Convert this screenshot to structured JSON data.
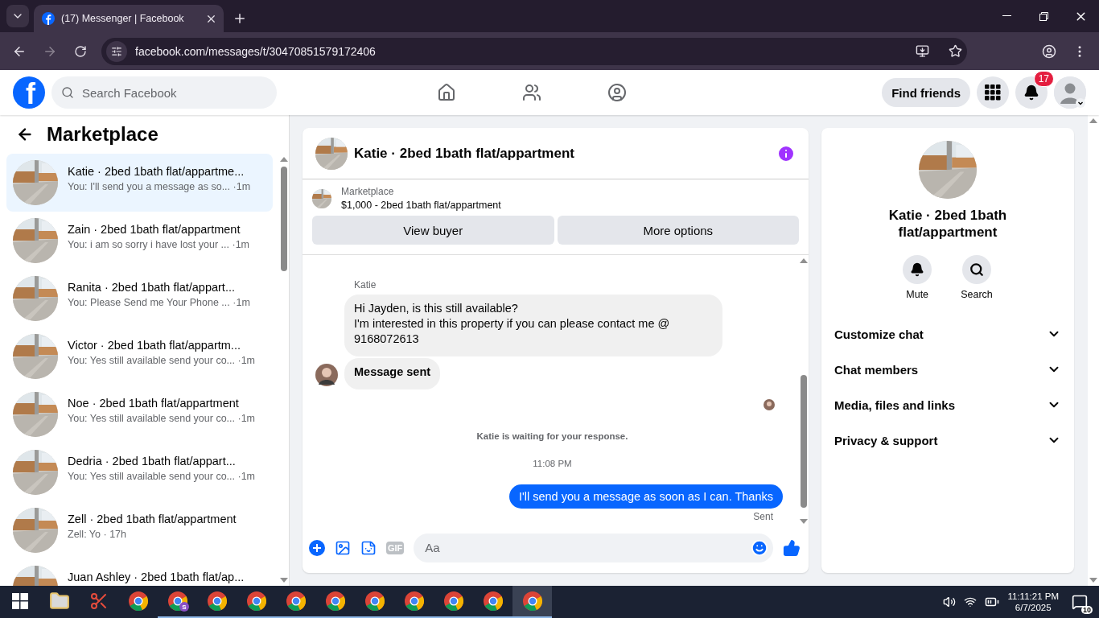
{
  "browser": {
    "tab": {
      "title": "(17) Messenger | Facebook",
      "selected": true
    },
    "url": "facebook.com/messages/t/30470851579172406"
  },
  "header": {
    "logo": "f",
    "search_placeholder": "Search Facebook",
    "find_friends": "Find friends",
    "notification_count": "17"
  },
  "sidebar": {
    "title": "Marketplace",
    "conversations": [
      {
        "name": "Katie · 2bed 1bath flat/appartme...",
        "snippet": "You: I'll send you a message as so...",
        "time": "·1m",
        "selected": true
      },
      {
        "name": "Zain · 2bed 1bath flat/appartment",
        "snippet": "You: i am so sorry i have lost your ...",
        "time": "·1m",
        "selected": false
      },
      {
        "name": "Ranita · 2bed 1bath flat/appart...",
        "snippet": "You: Please Send me Your Phone ...",
        "time": "·1m",
        "selected": false
      },
      {
        "name": "Victor · 2bed 1bath flat/appartm...",
        "snippet": "You: Yes still available send your co...",
        "time": "·1m",
        "selected": false
      },
      {
        "name": "Noe · 2bed 1bath flat/appartment",
        "snippet": "You: Yes still available send your co...",
        "time": "·1m",
        "selected": false
      },
      {
        "name": "Dedria · 2bed 1bath flat/appart...",
        "snippet": "You: Yes still available send your co...",
        "time": "·1m",
        "selected": false
      },
      {
        "name": "Zell · 2bed 1bath flat/appartment",
        "snippet": "Zell: Yo",
        "time": "· 17h",
        "selected": false
      },
      {
        "name": "Juan Ashley · 2bed 1bath flat/ap...",
        "selected": false
      }
    ]
  },
  "chat": {
    "title": "Katie · 2bed 1bath flat/appartment",
    "listing": {
      "label": "Marketplace",
      "title": "$1,000 - 2bed 1bath flat/appartment",
      "buttons": [
        "View buyer",
        "More options"
      ]
    },
    "messages": [
      {
        "kind": "sender",
        "text": "Katie"
      },
      {
        "kind": "incoming",
        "text": "Hi Jayden, is this still available?\nI'm interested in this property if you can please contact me @ 9168072613",
        "bold": false,
        "avatar": false
      },
      {
        "kind": "incoming",
        "text": "Message sent",
        "bold": true,
        "avatar": true
      },
      {
        "kind": "seen"
      },
      {
        "kind": "notice",
        "text": "Katie is waiting for your response."
      },
      {
        "kind": "time",
        "text": "11:08 PM"
      },
      {
        "kind": "outgoing",
        "text": "I'll send you a message as soon as I can. Thanks"
      },
      {
        "kind": "status",
        "text": "Sent"
      }
    ],
    "composer": {
      "gif": "GIF",
      "placeholder": "Aa"
    }
  },
  "details": {
    "name": "Katie · 2bed 1bath flat/appartment",
    "actions": [
      {
        "kind": "mute",
        "label": "Mute"
      },
      {
        "kind": "search",
        "label": "Search"
      }
    ],
    "sections": [
      {
        "label": "Customize chat",
        "expanded": false
      },
      {
        "label": "Chat members",
        "expanded": false
      },
      {
        "label": "Media, files and links",
        "expanded": false
      },
      {
        "label": "Privacy & support",
        "expanded": false
      }
    ]
  },
  "taskbar": {
    "apps": [
      {
        "kind": "files",
        "running": false,
        "selected": false
      },
      {
        "kind": "snip",
        "running": false,
        "selected": false
      },
      {
        "kind": "chrome",
        "running": false,
        "selected": false
      },
      {
        "kind": "chrome",
        "badge": "S",
        "running": true,
        "selected": false
      },
      {
        "kind": "chrome",
        "running": true,
        "selected": false
      },
      {
        "kind": "chrome",
        "running": true,
        "selected": false
      },
      {
        "kind": "chrome",
        "running": true,
        "selected": false
      },
      {
        "kind": "chrome",
        "running": true,
        "selected": false
      },
      {
        "kind": "chrome",
        "running": true,
        "selected": false
      },
      {
        "kind": "chrome",
        "running": true,
        "selected": false
      },
      {
        "kind": "chrome",
        "running": true,
        "selected": false
      },
      {
        "kind": "chrome",
        "running": true,
        "selected": false
      },
      {
        "kind": "chrome",
        "running": true,
        "selected": true
      }
    ],
    "time": "11:11:21 PM",
    "date": "6/7/2025",
    "notifications": "10"
  }
}
